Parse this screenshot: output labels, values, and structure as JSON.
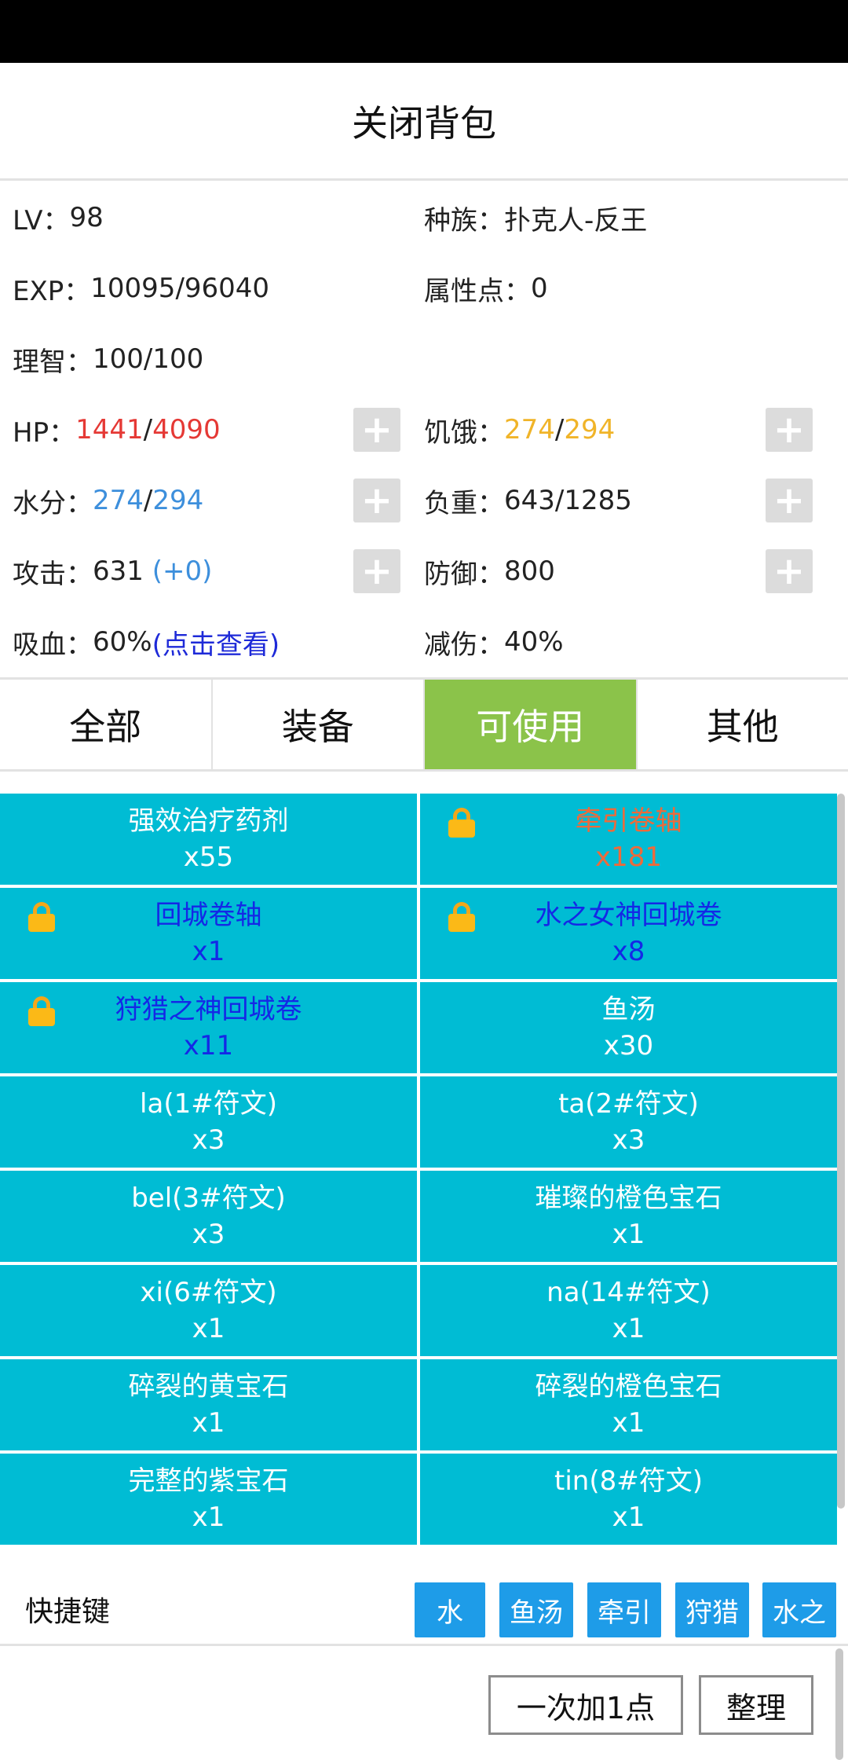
{
  "header": {
    "title": "关闭背包"
  },
  "stats": {
    "lv": {
      "label": "LV：",
      "value": "98"
    },
    "race": {
      "label": "种族：",
      "value": "扑克人-反王"
    },
    "exp": {
      "label": "EXP：",
      "value": "10095/96040"
    },
    "attr_points": {
      "label": "属性点：",
      "value": "0"
    },
    "sanity": {
      "label": "理智：",
      "value": "100/100"
    },
    "hp": {
      "label": "HP：",
      "current": "1441",
      "sep": "/",
      "max": "4090"
    },
    "hunger": {
      "label": "饥饿：",
      "current": "274",
      "sep": "/",
      "max": "294"
    },
    "water": {
      "label": "水分：",
      "current": "274",
      "sep": "/",
      "max": "294"
    },
    "load": {
      "label": "负重：",
      "value": "643/1285"
    },
    "attack": {
      "label": "攻击：",
      "value": "631 ",
      "bonus": "(+0)"
    },
    "defense": {
      "label": "防御：",
      "value": "800"
    },
    "lifesteal": {
      "label": "吸血：",
      "value": "60%",
      "link": "(点击查看)"
    },
    "dmg_reduction": {
      "label": "减伤：",
      "value": "40%"
    },
    "plus_symbol": "+"
  },
  "tabs": [
    {
      "label": "全部",
      "active": false
    },
    {
      "label": "装备",
      "active": false
    },
    {
      "label": "可使用",
      "active": true
    },
    {
      "label": "其他",
      "active": false
    }
  ],
  "items": [
    {
      "name": "强效治疗药剂",
      "count": "x55",
      "locked": false
    },
    {
      "name": "牵引卷轴",
      "count": "x181",
      "locked": true
    },
    {
      "name": "回城卷轴",
      "count": "x1",
      "locked": true
    },
    {
      "name": "水之女神回城卷",
      "count": "x8",
      "locked": true
    },
    {
      "name": "狩猎之神回城卷",
      "count": "x11",
      "locked": true
    },
    {
      "name": "鱼汤",
      "count": "x30",
      "locked": false
    },
    {
      "name": "la(1#符文)",
      "count": "x3",
      "locked": false
    },
    {
      "name": "ta(2#符文)",
      "count": "x3",
      "locked": false
    },
    {
      "name": "bel(3#符文)",
      "count": "x3",
      "locked": false
    },
    {
      "name": "璀璨的橙色宝石",
      "count": "x1",
      "locked": false
    },
    {
      "name": "xi(6#符文)",
      "count": "x1",
      "locked": false
    },
    {
      "name": "na(14#符文)",
      "count": "x1",
      "locked": false
    },
    {
      "name": "碎裂的黄宝石",
      "count": "x1",
      "locked": false
    },
    {
      "name": "碎裂的橙色宝石",
      "count": "x1",
      "locked": false
    },
    {
      "name": "完整的紫宝石",
      "count": "x1",
      "locked": false
    },
    {
      "name": "tin(8#符文)",
      "count": "x1",
      "locked": false
    }
  ],
  "hotkeys": {
    "label": "快捷键",
    "keys": [
      "水",
      "鱼汤",
      "牵引",
      "狩猎",
      "水之"
    ]
  },
  "buttons": {
    "add_one": "一次加1点",
    "sort": "整理"
  },
  "colors": {
    "accent_green": "#8bc34a",
    "item_bg": "#00bcd4",
    "hotkey_bg": "#1e9ce8",
    "hp_red": "#e53935",
    "water_blue": "#3d8fdc",
    "hunger_yellow": "#f0b429",
    "locked_blue_text": "#1428e6",
    "locked_orange_text": "#ee6a3a"
  },
  "icons": {
    "lock": "lock-icon",
    "plus": "plus-icon"
  }
}
